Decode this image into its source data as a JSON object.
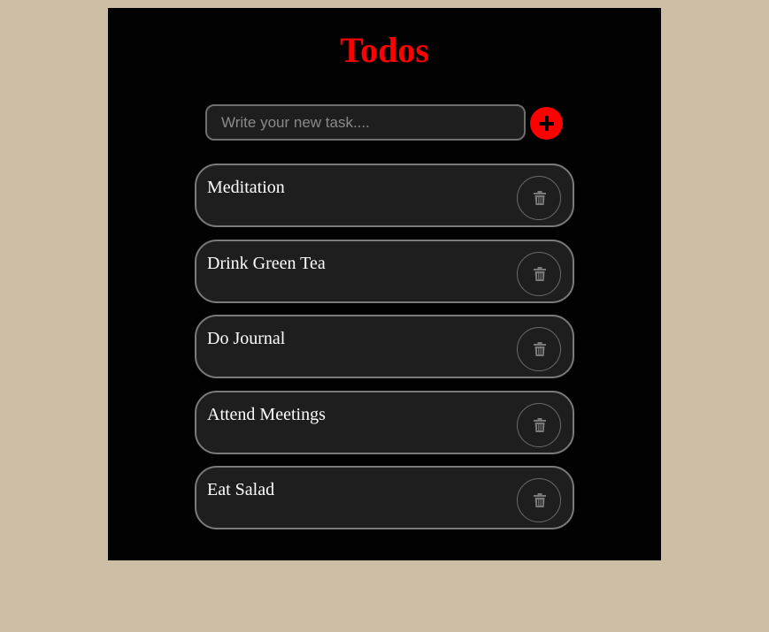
{
  "app": {
    "title": "Todos"
  },
  "new_task": {
    "placeholder": "Write your new task....",
    "value": "",
    "add_icon": "plus-icon"
  },
  "todos": [
    {
      "text": "Meditation",
      "delete_icon": "trash-icon"
    },
    {
      "text": "Drink Green Tea",
      "delete_icon": "trash-icon"
    },
    {
      "text": "Do Journal",
      "delete_icon": "trash-icon"
    },
    {
      "text": "Attend Meetings",
      "delete_icon": "trash-icon"
    },
    {
      "text": "Eat Salad",
      "delete_icon": "trash-icon"
    }
  ],
  "colors": {
    "page_background": "#cdbfa6",
    "app_background": "#020202",
    "accent": "#ff0000",
    "item_background": "#1e1e1e",
    "item_border": "#7a7a7a",
    "icon_gray": "#7a7a7a"
  }
}
